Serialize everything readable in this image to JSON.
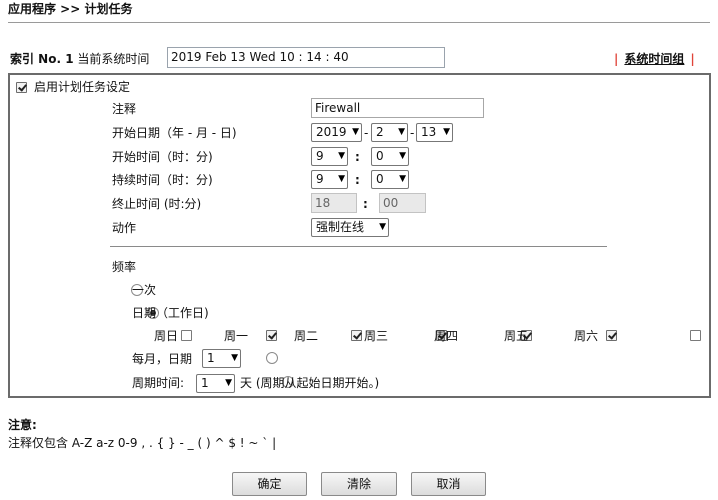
{
  "breadcrumb": "应用程序 >> 计划任务",
  "header": {
    "index_label": "索引 No. 1",
    "current_time_label": "当前系统时间",
    "current_time_value": "2019 Feb 13 Wed 10 : 14 : 40",
    "group_link": "系统时间组"
  },
  "enable": {
    "label": "启用计划任务设定",
    "checked": true
  },
  "form": {
    "comment_label": "注释",
    "comment_value": "Firewall",
    "start_date_label": "开始日期（年 - 月 - 日)",
    "start_year": "2019",
    "start_month": "2",
    "start_day": "13",
    "date_sep": "-",
    "start_time_label": "开始时间（时：分)",
    "start_hour": "9",
    "start_minute": "0",
    "duration_label": "持续时间（时：分)",
    "duration_hour": "9",
    "duration_minute": "0",
    "end_time_label": "终止时间 (时:分)",
    "end_hour": "18",
    "end_minute": "00",
    "colon": ":",
    "action_label": "动作",
    "action_value": "强制在线"
  },
  "frequency": {
    "title": "频率",
    "once_label": "一次",
    "weekdays_label": "日期（工作日)",
    "selected": "weekdays",
    "days": [
      {
        "label": "周日",
        "checked": false
      },
      {
        "label": "周一",
        "checked": true
      },
      {
        "label": "周二",
        "checked": true
      },
      {
        "label": "周三",
        "checked": true
      },
      {
        "label": "周四",
        "checked": true
      },
      {
        "label": "周五",
        "checked": true
      },
      {
        "label": "周六",
        "checked": false
      }
    ],
    "monthly_label": "每月，日期",
    "monthly_value": "1",
    "cycle_label": "周期时间:",
    "cycle_value": "1",
    "cycle_suffix": "天 (周期从起始日期开始。)"
  },
  "note": {
    "title": "注意:",
    "text": "注释仅包含 A-Z a-z 0-9 , . { } - _ ( ) ^ $ ! ~ ` |"
  },
  "buttons": {
    "ok": "确定",
    "clear": "清除",
    "cancel": "取消"
  }
}
